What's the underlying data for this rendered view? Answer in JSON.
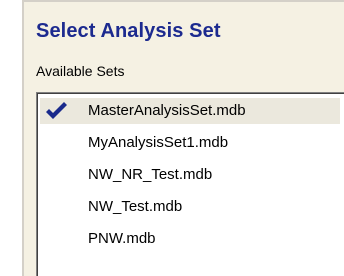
{
  "header": {
    "title": "Select Analysis Set",
    "subtitle": "Available Sets"
  },
  "sets": {
    "items": [
      {
        "label": "MasterAnalysisSet.mdb",
        "checked": true,
        "icon": "checkmark-icon"
      },
      {
        "label": "MyAnalysisSet1.mdb",
        "checked": false
      },
      {
        "label": "NW_NR_Test.mdb",
        "checked": false
      },
      {
        "label": "NW_Test.mdb",
        "checked": false
      },
      {
        "label": "PNW.mdb",
        "checked": false
      }
    ]
  },
  "colors": {
    "title": "#1c2a8f",
    "checkmark": "#1a2a8c",
    "panel_background": "#f5f1e3",
    "list_background": "#ffffff"
  }
}
